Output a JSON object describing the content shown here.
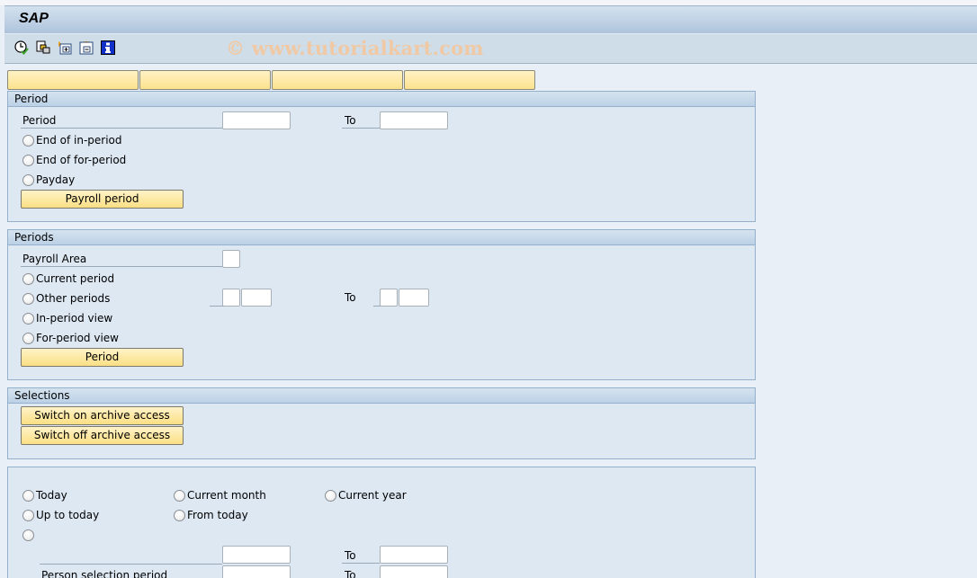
{
  "window": {
    "title": "SAP"
  },
  "toolbar": {
    "icons": [
      {
        "name": "execute-clock-icon",
        "label": "Execute"
      },
      {
        "name": "copy-variant-icon",
        "label": "Get Variant"
      },
      {
        "name": "expand-icon",
        "label": "Expand"
      },
      {
        "name": "collapse-icon",
        "label": "Collapse"
      },
      {
        "name": "info-icon",
        "label": "Information"
      }
    ],
    "watermark": "© www.tutorialkart.com"
  },
  "tab_buttons": [
    "",
    "",
    "",
    ""
  ],
  "period_group": {
    "title": "Period",
    "period_label": "Period",
    "period_from": "",
    "to_label": "To",
    "period_to": "",
    "radios": [
      "End of in-period",
      "End of for-period",
      "Payday"
    ],
    "button": "Payroll period"
  },
  "periods_group": {
    "title": "Periods",
    "payroll_area_label": "Payroll Area",
    "payroll_area_value": "",
    "radios": [
      "Current period",
      "Other periods",
      "In-period view",
      "For-period view"
    ],
    "other_from_1": "",
    "other_from_2": "",
    "to_label": "To",
    "other_to_1": "",
    "other_to_2": "",
    "button": "Period"
  },
  "selections_group": {
    "title": "Selections",
    "buttons": [
      "Switch on archive access",
      "Switch off archive access"
    ]
  },
  "date_group": {
    "radios_row1": [
      "Today",
      "Current month",
      "Current year"
    ],
    "radios_row2": [
      "Up to today",
      "From today"
    ],
    "custom_from": "",
    "to_label": "To",
    "custom_to": "",
    "person_selection_label": "Person selection period",
    "person_from": "",
    "person_to": ""
  }
}
